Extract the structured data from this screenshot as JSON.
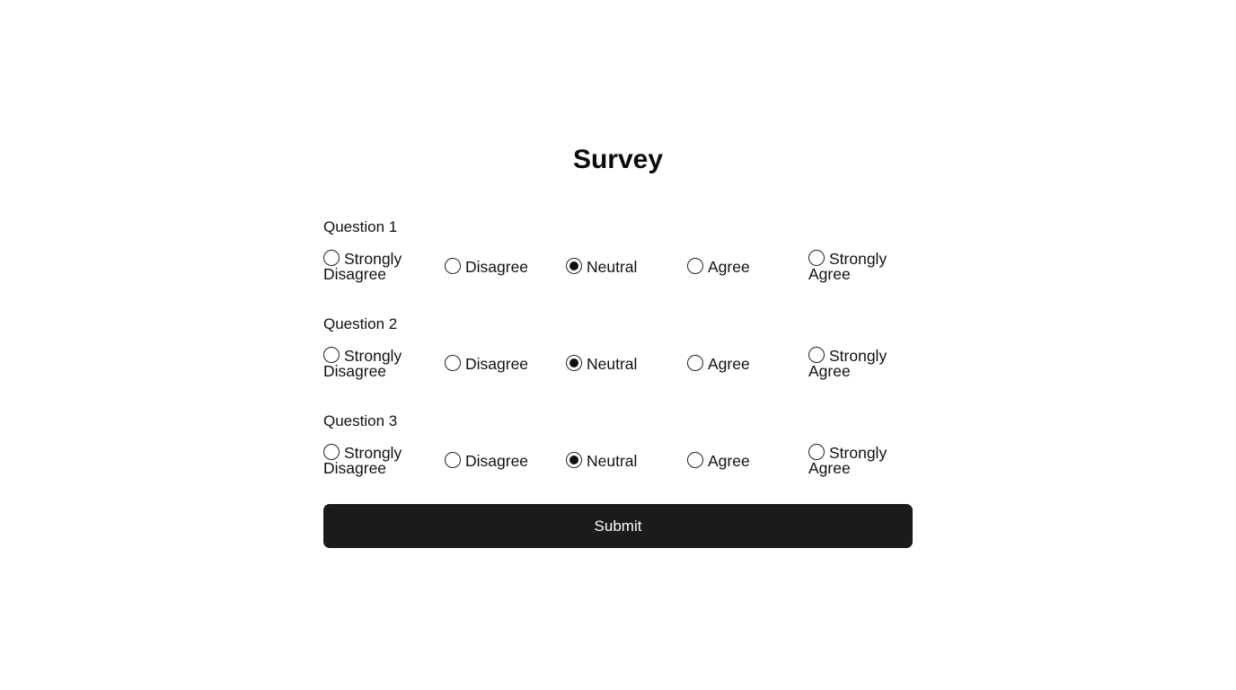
{
  "title": "Survey",
  "options": [
    "Strongly Disagree",
    "Disagree",
    "Neutral",
    "Agree",
    "Strongly Agree"
  ],
  "questions": [
    {
      "label": "Question 1",
      "selected": "Neutral"
    },
    {
      "label": "Question 2",
      "selected": "Neutral"
    },
    {
      "label": "Question 3",
      "selected": "Neutral"
    }
  ],
  "submit_label": "Submit",
  "colors": {
    "button_bg": "#1b1b1d",
    "button_text": "#ffffff"
  }
}
